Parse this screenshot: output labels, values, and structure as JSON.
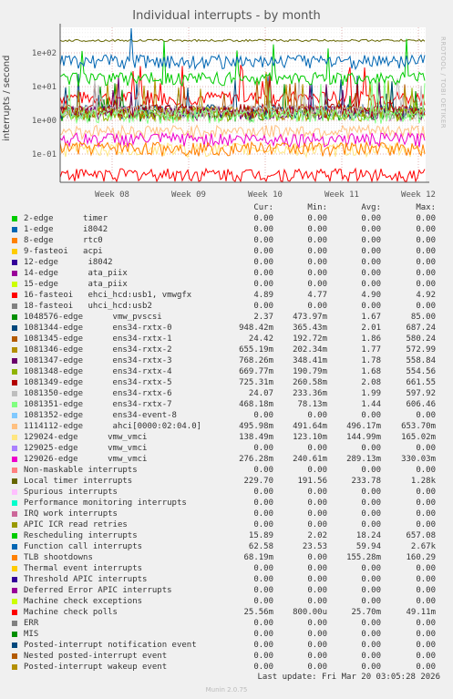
{
  "chart_data": {
    "type": "line",
    "title": "Individual interrupts - by month",
    "side_credit": "RRDTOOL / TOBI OETIKER",
    "ylabel": "interrupts / second",
    "y_scale": "log",
    "ylim": [
      0.01,
      300
    ],
    "y_ticks": [
      {
        "value": 100,
        "label": "1e+02"
      },
      {
        "value": 10,
        "label": "1e+01"
      },
      {
        "value": 1,
        "label": "1e+00"
      },
      {
        "value": 0.1,
        "label": "1e-01"
      }
    ],
    "x_ticks": [
      "Week 08",
      "Week 09",
      "Week 10",
      "Week 11",
      "Week 12"
    ],
    "grid": true,
    "columns": [
      "Cur:",
      "Min:",
      "Avg:",
      "Max:"
    ],
    "series": [
      {
        "name": "2-edge      timer",
        "color": "#00cc00",
        "cur": "0.00",
        "min": "0.00",
        "avg": "0.00",
        "max": "0.00",
        "level": 0
      },
      {
        "name": "1-edge      i8042",
        "color": "#0066b3",
        "cur": "0.00",
        "min": "0.00",
        "avg": "0.00",
        "max": "0.00",
        "level": 0
      },
      {
        "name": "8-edge      rtc0",
        "color": "#ff8000",
        "cur": "0.00",
        "min": "0.00",
        "avg": "0.00",
        "max": "0.00",
        "level": 0
      },
      {
        "name": "9-fasteoi   acpi",
        "color": "#ffcc00",
        "cur": "0.00",
        "min": "0.00",
        "avg": "0.00",
        "max": "0.00",
        "level": 0
      },
      {
        "name": "12-edge      i8042",
        "color": "#330099",
        "cur": "0.00",
        "min": "0.00",
        "avg": "0.00",
        "max": "0.00",
        "level": 0
      },
      {
        "name": "14-edge      ata_piix",
        "color": "#990099",
        "cur": "0.00",
        "min": "0.00",
        "avg": "0.00",
        "max": "0.00",
        "level": 0
      },
      {
        "name": "15-edge      ata_piix",
        "color": "#ccff00",
        "cur": "0.00",
        "min": "0.00",
        "avg": "0.00",
        "max": "0.00",
        "level": 0
      },
      {
        "name": "16-fasteoi   ehci_hcd:usb1, vmwgfx",
        "color": "#ff0000",
        "cur": "4.89",
        "min": "4.77",
        "avg": "4.90",
        "max": "4.92",
        "level": 4.9
      },
      {
        "name": "18-fasteoi   uhci_hcd:usb2",
        "color": "#808080",
        "cur": "0.00",
        "min": "0.00",
        "avg": "0.00",
        "max": "0.00",
        "level": 0
      },
      {
        "name": "1048576-edge      vmw_pvscsi",
        "color": "#008f00",
        "cur": "2.37",
        "min": "473.97m",
        "avg": "1.67",
        "max": "85.00",
        "level": 1.67
      },
      {
        "name": "1081344-edge      ens34-rxtx-0",
        "color": "#00487d",
        "cur": "948.42m",
        "min": "365.43m",
        "avg": "2.01",
        "max": "687.24",
        "level": 2.01
      },
      {
        "name": "1081345-edge      ens34-rxtx-1",
        "color": "#b35a00",
        "cur": "24.42",
        "min": "192.72m",
        "avg": "1.86",
        "max": "580.24",
        "level": 1.86
      },
      {
        "name": "1081346-edge      ens34-rxtx-2",
        "color": "#b38f00",
        "cur": "655.19m",
        "min": "202.34m",
        "avg": "1.77",
        "max": "572.99",
        "level": 1.77
      },
      {
        "name": "1081347-edge      ens34-rxtx-3",
        "color": "#6b006b",
        "cur": "768.26m",
        "min": "348.41m",
        "avg": "1.78",
        "max": "558.84",
        "level": 1.78
      },
      {
        "name": "1081348-edge      ens34-rxtx-4",
        "color": "#8fb300",
        "cur": "669.77m",
        "min": "190.79m",
        "avg": "1.68",
        "max": "554.56",
        "level": 1.68
      },
      {
        "name": "1081349-edge      ens34-rxtx-5",
        "color": "#b30000",
        "cur": "725.31m",
        "min": "260.58m",
        "avg": "2.08",
        "max": "661.55",
        "level": 2.08
      },
      {
        "name": "1081350-edge      ens34-rxtx-6",
        "color": "#bebebe",
        "cur": "24.07",
        "min": "233.36m",
        "avg": "1.99",
        "max": "597.92",
        "level": 1.99
      },
      {
        "name": "1081351-edge      ens34-rxtx-7",
        "color": "#80ff80",
        "cur": "468.18m",
        "min": "78.13m",
        "avg": "1.44",
        "max": "606.46",
        "level": 1.44
      },
      {
        "name": "1081352-edge      ens34-event-8",
        "color": "#80c9ff",
        "cur": "0.00",
        "min": "0.00",
        "avg": "0.00",
        "max": "0.00",
        "level": 0
      },
      {
        "name": "1114112-edge      ahci[0000:02:04.0]",
        "color": "#ffc080",
        "cur": "495.98m",
        "min": "491.64m",
        "avg": "496.17m",
        "max": "653.70m",
        "level": 0.496
      },
      {
        "name": "129024-edge      vmw_vmci",
        "color": "#ffe680",
        "cur": "138.49m",
        "min": "123.10m",
        "avg": "144.99m",
        "max": "165.02m",
        "level": 0.145
      },
      {
        "name": "129025-edge      vmw_vmci",
        "color": "#aa80ff",
        "cur": "0.00",
        "min": "0.00",
        "avg": "0.00",
        "max": "0.00",
        "level": 0
      },
      {
        "name": "129026-edge      vmw_vmci",
        "color": "#ee00cc",
        "cur": "276.28m",
        "min": "240.61m",
        "avg": "289.13m",
        "max": "330.03m",
        "level": 0.289
      },
      {
        "name": "Non-maskable interrupts",
        "color": "#ff8080",
        "cur": "0.00",
        "min": "0.00",
        "avg": "0.00",
        "max": "0.00",
        "level": 0
      },
      {
        "name": "Local timer interrupts",
        "color": "#666600",
        "cur": "229.70",
        "min": "191.56",
        "avg": "233.78",
        "max": "1.28k",
        "level": 233.78
      },
      {
        "name": "Spurious interrupts",
        "color": "#ffbfff",
        "cur": "0.00",
        "min": "0.00",
        "avg": "0.00",
        "max": "0.00",
        "level": 0
      },
      {
        "name": "Performance monitoring interrupts",
        "color": "#00ffcc",
        "cur": "0.00",
        "min": "0.00",
        "avg": "0.00",
        "max": "0.00",
        "level": 0
      },
      {
        "name": "IRQ work interrupts",
        "color": "#cc6699",
        "cur": "0.00",
        "min": "0.00",
        "avg": "0.00",
        "max": "0.00",
        "level": 0
      },
      {
        "name": "APIC ICR read retries",
        "color": "#999900",
        "cur": "0.00",
        "min": "0.00",
        "avg": "0.00",
        "max": "0.00",
        "level": 0
      },
      {
        "name": "Rescheduling interrupts",
        "color": "#00cc00",
        "cur": "15.89",
        "min": "2.02",
        "avg": "18.24",
        "max": "657.08",
        "level": 18.24
      },
      {
        "name": "Function call interrupts",
        "color": "#0066b3",
        "cur": "62.58",
        "min": "23.53",
        "avg": "59.94",
        "max": "2.67k",
        "level": 59.94
      },
      {
        "name": "TLB shootdowns",
        "color": "#ff8000",
        "cur": "68.19m",
        "min": "0.00",
        "avg": "155.28m",
        "max": "160.29",
        "level": 0.155
      },
      {
        "name": "Thermal event interrupts",
        "color": "#ffcc00",
        "cur": "0.00",
        "min": "0.00",
        "avg": "0.00",
        "max": "0.00",
        "level": 0
      },
      {
        "name": "Threshold APIC interrupts",
        "color": "#330099",
        "cur": "0.00",
        "min": "0.00",
        "avg": "0.00",
        "max": "0.00",
        "level": 0
      },
      {
        "name": "Deferred Error APIC interrupts",
        "color": "#990099",
        "cur": "0.00",
        "min": "0.00",
        "avg": "0.00",
        "max": "0.00",
        "level": 0
      },
      {
        "name": "Machine check exceptions",
        "color": "#ccff00",
        "cur": "0.00",
        "min": "0.00",
        "avg": "0.00",
        "max": "0.00",
        "level": 0
      },
      {
        "name": "Machine check polls",
        "color": "#ff0000",
        "cur": "25.56m",
        "min": "800.00u",
        "avg": "25.70m",
        "max": "49.11m",
        "level": 0.0257
      },
      {
        "name": "ERR",
        "color": "#808080",
        "cur": "0.00",
        "min": "0.00",
        "avg": "0.00",
        "max": "0.00",
        "level": 0
      },
      {
        "name": "MIS",
        "color": "#008f00",
        "cur": "0.00",
        "min": "0.00",
        "avg": "0.00",
        "max": "0.00",
        "level": 0
      },
      {
        "name": "Posted-interrupt notification event",
        "color": "#00487d",
        "cur": "0.00",
        "min": "0.00",
        "avg": "0.00",
        "max": "0.00",
        "level": 0
      },
      {
        "name": "Nested posted-interrupt event",
        "color": "#b35a00",
        "cur": "0.00",
        "min": "0.00",
        "avg": "0.00",
        "max": "0.00",
        "level": 0
      },
      {
        "name": "Posted-interrupt wakeup event",
        "color": "#b38f00",
        "cur": "0.00",
        "min": "0.00",
        "avg": "0.00",
        "max": "0.00",
        "level": 0
      }
    ],
    "last_update": "Last update:  Fri Mar 20 03:05:28 2026",
    "generator": "Munin 2.0.75"
  }
}
